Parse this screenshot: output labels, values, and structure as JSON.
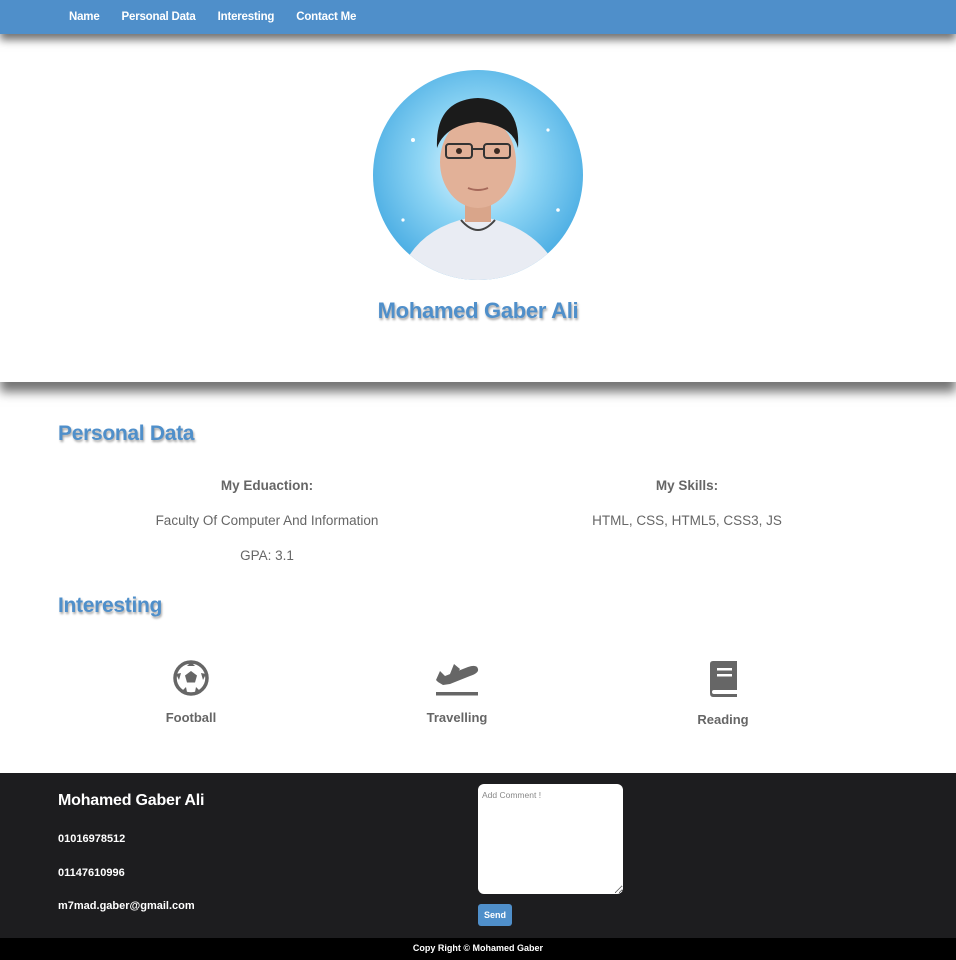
{
  "nav": {
    "items": [
      "Name",
      "Personal Data",
      "Interesting",
      "Contact Me"
    ]
  },
  "hero": {
    "name": "Mohamed Gaber Ali",
    "avatar_icon": "profile-photo"
  },
  "personal": {
    "title": "Personal Data",
    "education": {
      "heading": "My Eduaction:",
      "lines": [
        "Faculty Of Computer And Information",
        "GPA: 3.1"
      ]
    },
    "skills": {
      "heading": "My Skills:",
      "lines": [
        "HTML, CSS, HTML5, CSS3, JS"
      ]
    }
  },
  "interesting": {
    "title": "Interesting",
    "items": [
      {
        "label": "Football",
        "icon": "football-icon"
      },
      {
        "label": "Travelling",
        "icon": "plane-icon"
      },
      {
        "label": "Reading",
        "icon": "book-icon"
      }
    ]
  },
  "footer": {
    "name": "Mohamed Gaber Ali",
    "phone1": "01016978512",
    "phone2": "01147610996",
    "email": "m7mad.gaber@gmail.com",
    "comment_placeholder": "Add Comment !",
    "send_label": "Send",
    "copyright": "Copy Right © Mohamed Gaber"
  },
  "colors": {
    "accent": "#4f8fca",
    "footer_bg": "#1d1d1f",
    "copyright_bg": "#000000"
  }
}
